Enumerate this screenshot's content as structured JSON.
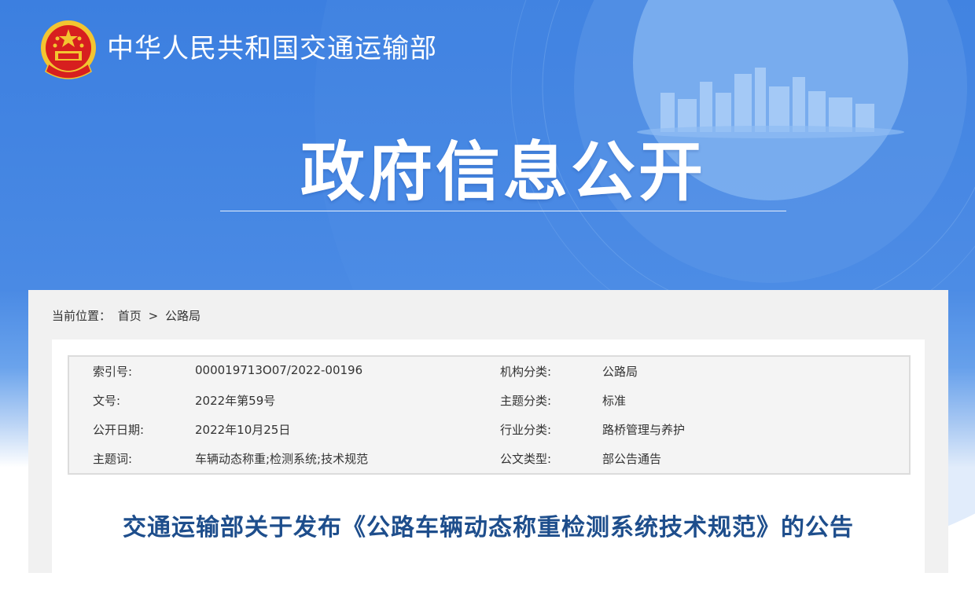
{
  "header": {
    "site_title": "中华人民共和国交通运输部",
    "page_heading": "政府信息公开",
    "emblem_icon": "national-emblem-icon"
  },
  "breadcrumb": {
    "label": "当前位置：",
    "home": "首页",
    "separator": ">",
    "current": "公路局"
  },
  "metadata": {
    "index_label": "索引号:",
    "index_value": "000019713O07/2022-00196",
    "org_label": "机构分类:",
    "org_value": "公路局",
    "doc_no_label": "文号:",
    "doc_no_value": "2022年第59号",
    "topic_label": "主题分类:",
    "topic_value": "标准",
    "date_label": "公开日期:",
    "date_value": "2022年10月25日",
    "industry_label": "行业分类:",
    "industry_value": "路桥管理与养护",
    "keywords_label": "主题词:",
    "keywords_value": "车辆动态称重;检测系统;技术规范",
    "doc_type_label": "公文类型:",
    "doc_type_value": "部公告通告"
  },
  "article": {
    "title": "交通运输部关于发布《公路车辆动态称重检测系统技术规范》的公告"
  },
  "colors": {
    "banner_blue": "#3c7fe0",
    "title_blue": "#1e4e8c",
    "emblem_red": "#d71f1f",
    "emblem_gold": "#f3c530"
  }
}
